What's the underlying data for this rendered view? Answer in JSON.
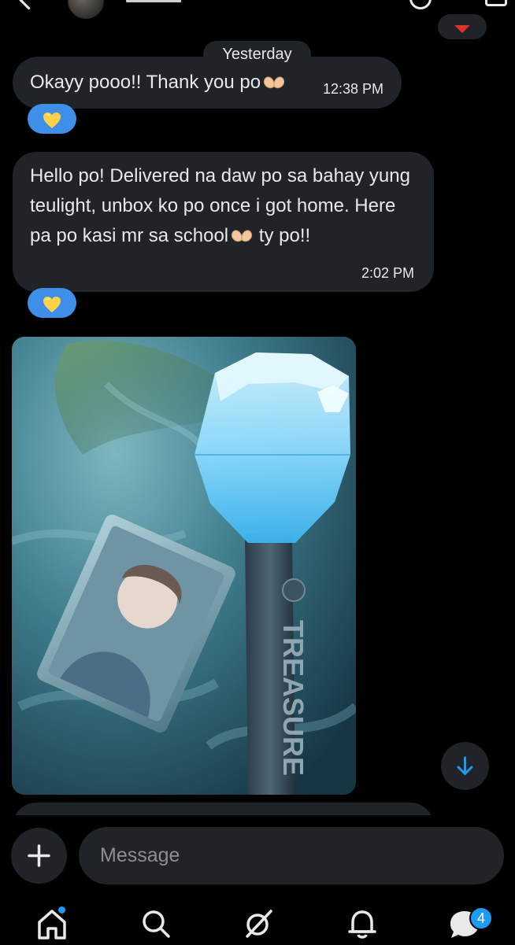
{
  "separator": {
    "date": "Yesterday"
  },
  "messages": [
    {
      "text": "Okayy pooo!! Thank you po",
      "emoji": "🫶",
      "time": "12:38 PM",
      "reaction": "💛"
    },
    {
      "text": "Hello po! Delivered na daw po sa bahay yung teulight, unbox ko po once i got home. Here pa po kasi mr sa school",
      "emoji": "🫶",
      "text_after": " ty po!!",
      "time": "2:02 PM",
      "reaction": "💛"
    }
  ],
  "attachment": {
    "lightstick_text": "TREASURE"
  },
  "composer": {
    "placeholder": "Message"
  },
  "nav": {
    "messages_badge": "4"
  },
  "colors": {
    "background": "#000000",
    "bubble": "#202327",
    "reaction": "#3f8ee8",
    "accent": "#1d9bf0",
    "alert": "#e0312f"
  },
  "icons": {
    "top": [
      "back-icon",
      "avatar",
      "call-icon",
      "video-icon"
    ],
    "composer": "plus-icon",
    "scroll": "arrow-down-icon",
    "nav": [
      "home-icon",
      "search-icon",
      "grok-icon",
      "bell-icon",
      "messages-icon"
    ]
  }
}
